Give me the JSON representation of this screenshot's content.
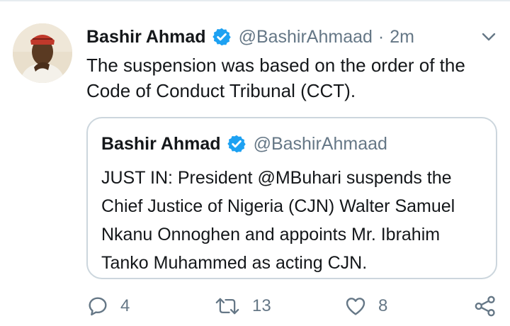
{
  "tweet": {
    "author_name": "Bashir Ahmad",
    "author_handle": "@BashirAhmaad",
    "separator": "·",
    "time": "2m",
    "text": "The suspension was based on the order of the Code of Conduct Tribunal (CCT).",
    "icons": {
      "verified": "verified-badge-icon",
      "menu": "chevron-down-icon"
    }
  },
  "quoted_tweet": {
    "author_name": "Bashir Ahmad",
    "author_handle": "@BashirAhmaad",
    "text": "JUST IN: President @MBuhari suspends the Chief Justice of Nigeria (CJN) Walter Samuel Nkanu Onnoghen and appoints Mr. Ibrahim Tanko Muhammed as acting CJN."
  },
  "actions": {
    "reply": {
      "icon": "reply-icon",
      "count": "4"
    },
    "retweet": {
      "icon": "retweet-icon",
      "count": "13"
    },
    "like": {
      "icon": "heart-icon",
      "count": "8"
    },
    "share": {
      "icon": "share-icon"
    }
  },
  "colors": {
    "verified_blue": "#1da1f2",
    "secondary_text": "#657786",
    "border": "#ccd6dd"
  }
}
